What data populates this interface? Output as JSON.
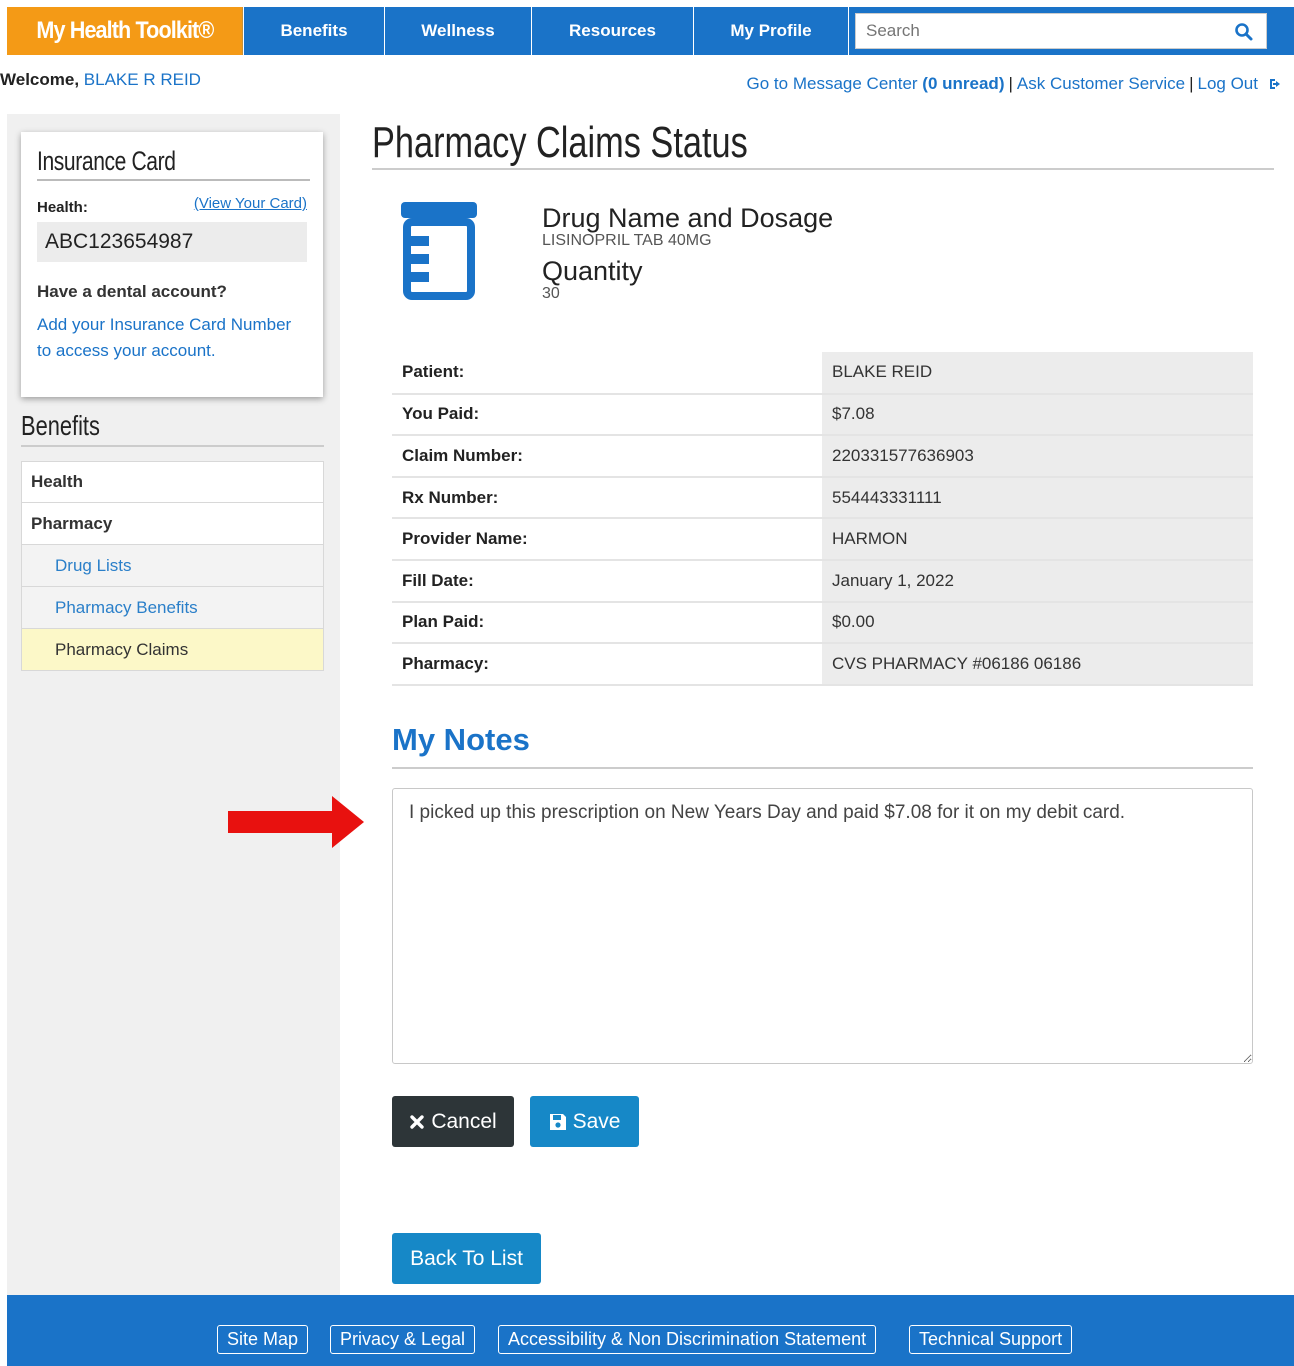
{
  "header": {
    "logo": "My Health Toolkit®",
    "nav": [
      "Benefits",
      "Wellness",
      "Resources",
      "My Profile"
    ],
    "search_placeholder": "Search"
  },
  "welcome": {
    "label": "Welcome,",
    "name": "BLAKE R REID"
  },
  "toplinks": {
    "message_center": "Go to Message Center",
    "unread": "(0 unread)",
    "sep1": "|",
    "customer_service": "Ask Customer Service",
    "sep2": "|",
    "logout": "Log Out"
  },
  "insurance_card": {
    "title": "Insurance Card",
    "health_label": "Health:",
    "view_card": "(View Your Card)",
    "number": "ABC123654987",
    "dental_question": "Have a dental account?",
    "dental_link": "Add your Insurance Card Number to access your account."
  },
  "benefits_nav": {
    "title": "Benefits",
    "items": [
      "Health",
      "Pharmacy",
      "Drug Lists",
      "Pharmacy Benefits",
      "Pharmacy Claims"
    ]
  },
  "main": {
    "title": "Pharmacy Claims Status",
    "drug_label": "Drug Name and Dosage",
    "drug_value": "LISINOPRIL TAB 40MG",
    "quantity_label": "Quantity",
    "quantity_value": "30",
    "claim_rows": [
      {
        "k": "Patient:",
        "v": "BLAKE REID"
      },
      {
        "k": "You Paid:",
        "v": "$7.08"
      },
      {
        "k": "Claim Number:",
        "v": "220331577636903"
      },
      {
        "k": "Rx Number:",
        "v": "554443331111"
      },
      {
        "k": "Provider Name:",
        "v": "HARMON"
      },
      {
        "k": "Fill Date:",
        "v": "January 1, 2022"
      },
      {
        "k": "Plan Paid:",
        "v": "$0.00"
      },
      {
        "k": "Pharmacy:",
        "v": "CVS PHARMACY #06186 06186"
      }
    ],
    "notes_title": "My Notes",
    "notes_text": "I picked up this prescription on New Years Day and paid $7.08 for it on my debit card.",
    "cancel_label": "Cancel",
    "save_label": "Save",
    "back_label": "Back To List"
  },
  "footer": {
    "links": [
      "Site Map",
      "Privacy & Legal",
      "Accessibility & Non Discrimination Statement",
      "Technical Support"
    ]
  },
  "colors": {
    "nav_blue": "#1a73c8",
    "logo_orange": "#f49a16",
    "annotation_arrow": "#e8110f",
    "active_item": "#fcf8c8"
  }
}
